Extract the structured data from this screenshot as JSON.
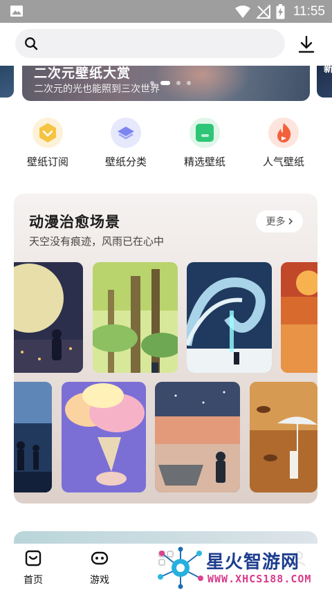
{
  "status_bar": {
    "time": "11:55",
    "icons": [
      "image-icon",
      "wifi-icon",
      "no-signal-icon",
      "battery-charging-icon"
    ]
  },
  "search": {
    "placeholder": "",
    "icon": "search-icon",
    "download_icon": "download-icon"
  },
  "banner": {
    "title": "二次元壁纸大赏",
    "subtitle": "二次元的光也能照到三次世界",
    "page_count": 4,
    "active_page": 1,
    "next_title_fragment": "新"
  },
  "quick_nav": [
    {
      "label": "壁纸订阅",
      "icon": "subscribe-icon",
      "color": "#f6c443"
    },
    {
      "label": "壁纸分类",
      "icon": "layers-icon",
      "color": "#7b86f0"
    },
    {
      "label": "精选壁纸",
      "icon": "wallet-icon",
      "color": "#2fc576"
    },
    {
      "label": "人气壁纸",
      "icon": "flame-icon",
      "color": "#f2603c"
    }
  ],
  "anime_card": {
    "title": "动漫治愈场景",
    "subtitle": "天空没有痕迹，风雨已在心中",
    "more_label": "更多",
    "thumbnails_row1": [
      "full-moon-wallpaper",
      "forest-wallpaper",
      "wave-wallpaper",
      "sunset-red-wallpaper"
    ],
    "thumbnails_row2": [
      "night-kids-wallpaper",
      "cloud-icecream-wallpaper",
      "boat-sea-wallpaper",
      "umbrella-autumn-wallpaper"
    ]
  },
  "bottom_nav": [
    {
      "label": "首页",
      "icon": "home-icon",
      "active": true
    },
    {
      "label": "游戏",
      "icon": "gamepad-icon",
      "active": false
    },
    {
      "label": "",
      "icon": "apps-icon",
      "active": false
    },
    {
      "label": "",
      "icon": "profile-icon",
      "active": false
    }
  ],
  "watermark": {
    "title": "星火智游网",
    "url": "WWW.XHCS188.COM"
  },
  "colors": {
    "status_bar": "#9e9e9e",
    "search_bg": "#f1f1f3",
    "card_bg": "#ece4e0",
    "watermark_blue": "#1d3d8f",
    "watermark_pink": "#d93a8b"
  }
}
